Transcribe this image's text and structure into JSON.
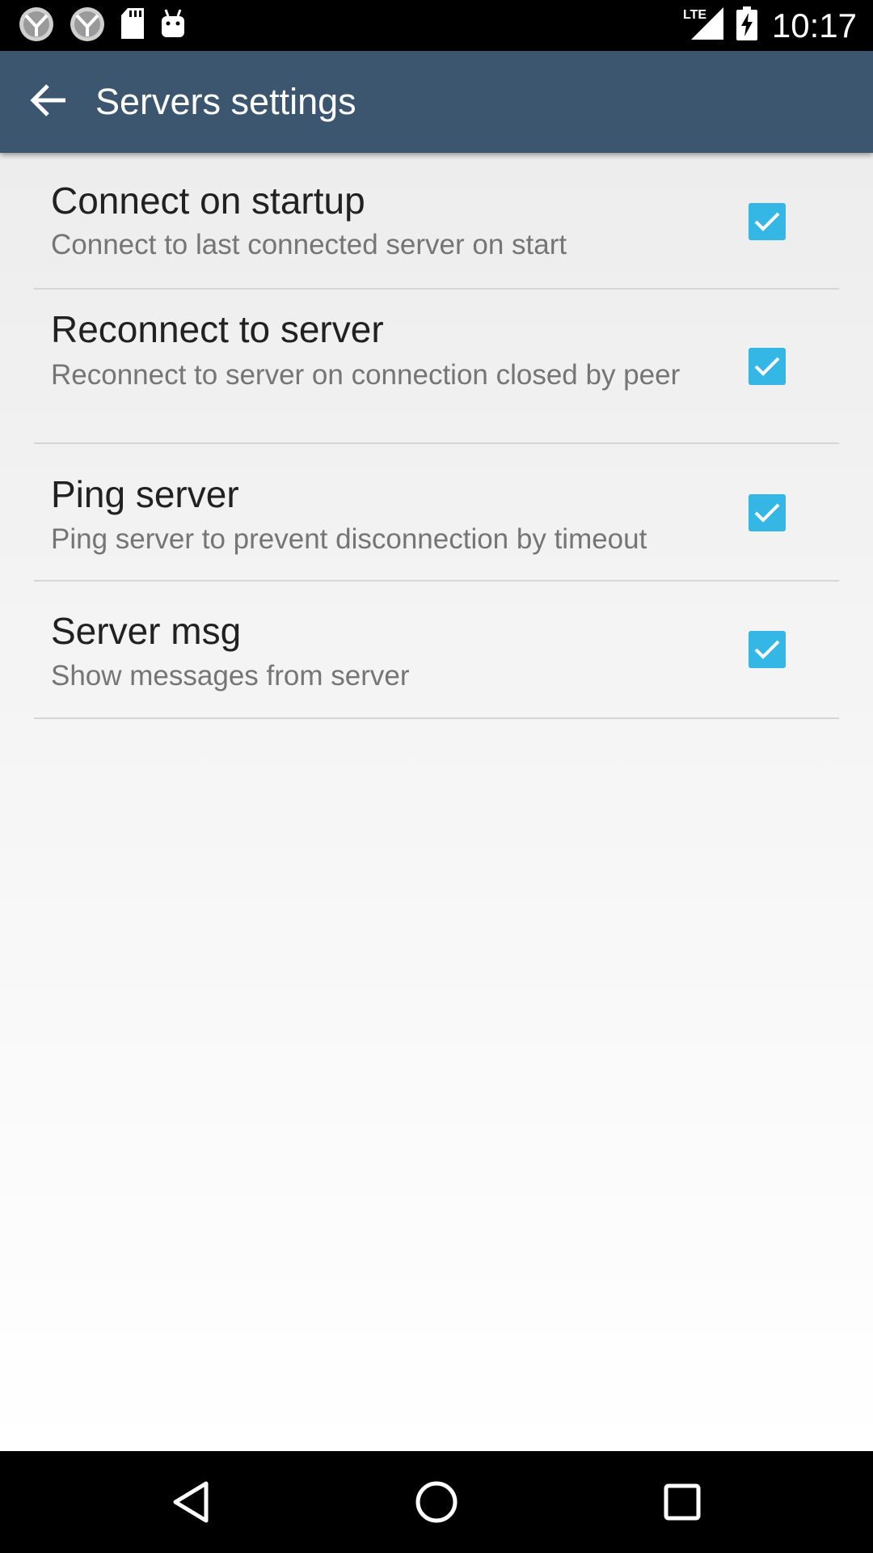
{
  "status_bar": {
    "time": "10:17",
    "network_label": "LTE",
    "icons": [
      "app-notification-icon",
      "app-notification-icon",
      "sd-card-icon",
      "android-debug-icon",
      "lte-signal-icon",
      "battery-charging-icon"
    ]
  },
  "app_bar": {
    "title": "Servers settings",
    "back_icon": "arrow-back-icon",
    "color": "#3b566e"
  },
  "preferences": [
    {
      "title": "Connect on startup",
      "summary": "Connect to last connected server on start",
      "checked": true
    },
    {
      "title": "Reconnect to server",
      "summary": "Reconnect to server on connection closed by peer",
      "checked": true
    },
    {
      "title": "Ping server",
      "summary": "Ping server to prevent disconnection by timeout",
      "checked": true
    },
    {
      "title": "Server msg",
      "summary": "Show messages from server",
      "checked": true
    }
  ],
  "accent_color": "#35b7e5",
  "nav_bar": {
    "icons": [
      "back-triangle-icon",
      "home-circle-icon",
      "recents-square-icon"
    ]
  }
}
